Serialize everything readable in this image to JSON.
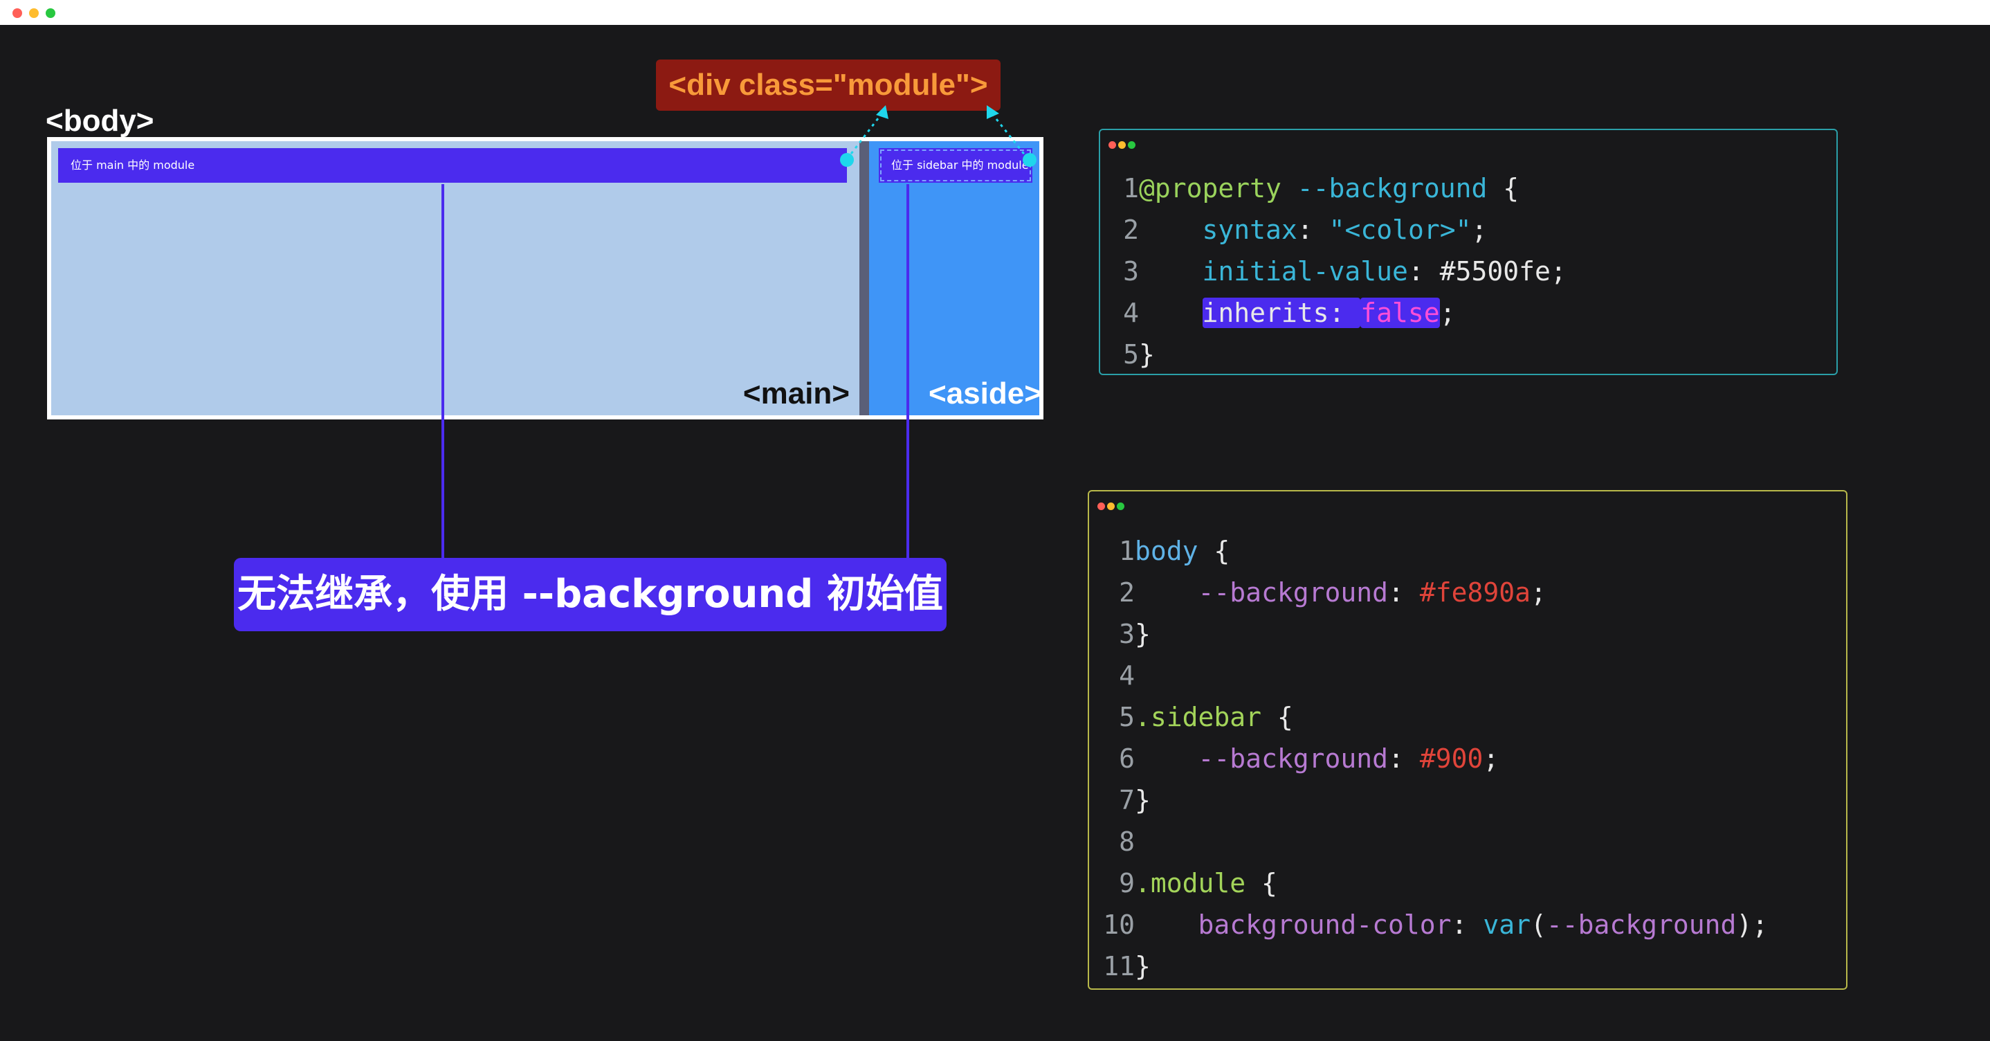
{
  "diagram": {
    "body_label": "<body>",
    "main_label": "<main>",
    "aside_label": "<aside>",
    "module_main_label": "位于 main 中的 module",
    "module_aside_label": "位于 sidebar 中的 module",
    "div_label": "<div class=\"module\">",
    "callout": "无法继承，使用 --background 初始值"
  },
  "code_panel_1": {
    "lines": [
      {
        "n": "1",
        "parts": [
          [
            "c-at",
            "@property"
          ],
          [
            "c-plain",
            " "
          ],
          [
            "c-kw",
            "--background"
          ],
          [
            "c-plain",
            " {"
          ]
        ]
      },
      {
        "n": "2",
        "parts": [
          [
            "c-plain",
            "    "
          ],
          [
            "c-prop",
            "syntax"
          ],
          [
            "c-plain",
            ": "
          ],
          [
            "c-str",
            "\"<color>\""
          ],
          [
            "c-plain",
            ";"
          ]
        ]
      },
      {
        "n": "3",
        "parts": [
          [
            "c-plain",
            "    "
          ],
          [
            "c-prop",
            "initial-value"
          ],
          [
            "c-plain",
            ": #5500fe;"
          ]
        ]
      },
      {
        "n": "4",
        "parts": [
          [
            "c-plain",
            "    "
          ],
          [
            "hl c-plain",
            "inherits: "
          ],
          [
            "hl c-bool",
            "false"
          ],
          [
            "c-plain",
            ";"
          ]
        ]
      },
      {
        "n": "5",
        "parts": [
          [
            "c-plain",
            "}"
          ]
        ]
      }
    ]
  },
  "code_panel_2": {
    "lines": [
      {
        "n": "1",
        "parts": [
          [
            "c-sel",
            "body"
          ],
          [
            "c-plain",
            " {"
          ]
        ]
      },
      {
        "n": "2",
        "parts": [
          [
            "c-plain",
            "    "
          ],
          [
            "c-var",
            "--background"
          ],
          [
            "c-plain",
            ": "
          ],
          [
            "c-hex",
            "#fe890a"
          ],
          [
            "c-plain",
            ";"
          ]
        ]
      },
      {
        "n": "3",
        "parts": [
          [
            "c-plain",
            "}"
          ]
        ]
      },
      {
        "n": "4",
        "parts": []
      },
      {
        "n": "5",
        "parts": [
          [
            "c-cls",
            ".sidebar"
          ],
          [
            "c-plain",
            " {"
          ]
        ]
      },
      {
        "n": "6",
        "parts": [
          [
            "c-plain",
            "    "
          ],
          [
            "c-var",
            "--background"
          ],
          [
            "c-plain",
            ": "
          ],
          [
            "c-hex",
            "#900"
          ],
          [
            "c-plain",
            ";"
          ]
        ]
      },
      {
        "n": "7",
        "parts": [
          [
            "c-plain",
            "}"
          ]
        ]
      },
      {
        "n": "8",
        "parts": []
      },
      {
        "n": "9",
        "parts": [
          [
            "c-cls",
            ".module"
          ],
          [
            "c-plain",
            " {"
          ]
        ]
      },
      {
        "n": "10",
        "parts": [
          [
            "c-plain",
            "    "
          ],
          [
            "c-var",
            "background-color"
          ],
          [
            "c-plain",
            ": "
          ],
          [
            "c-fn",
            "var"
          ],
          [
            "c-plain",
            "("
          ],
          [
            "c-var",
            "--background"
          ],
          [
            "c-plain",
            ");"
          ]
        ]
      },
      {
        "n": "11",
        "parts": [
          [
            "c-plain",
            "}"
          ]
        ]
      }
    ]
  }
}
